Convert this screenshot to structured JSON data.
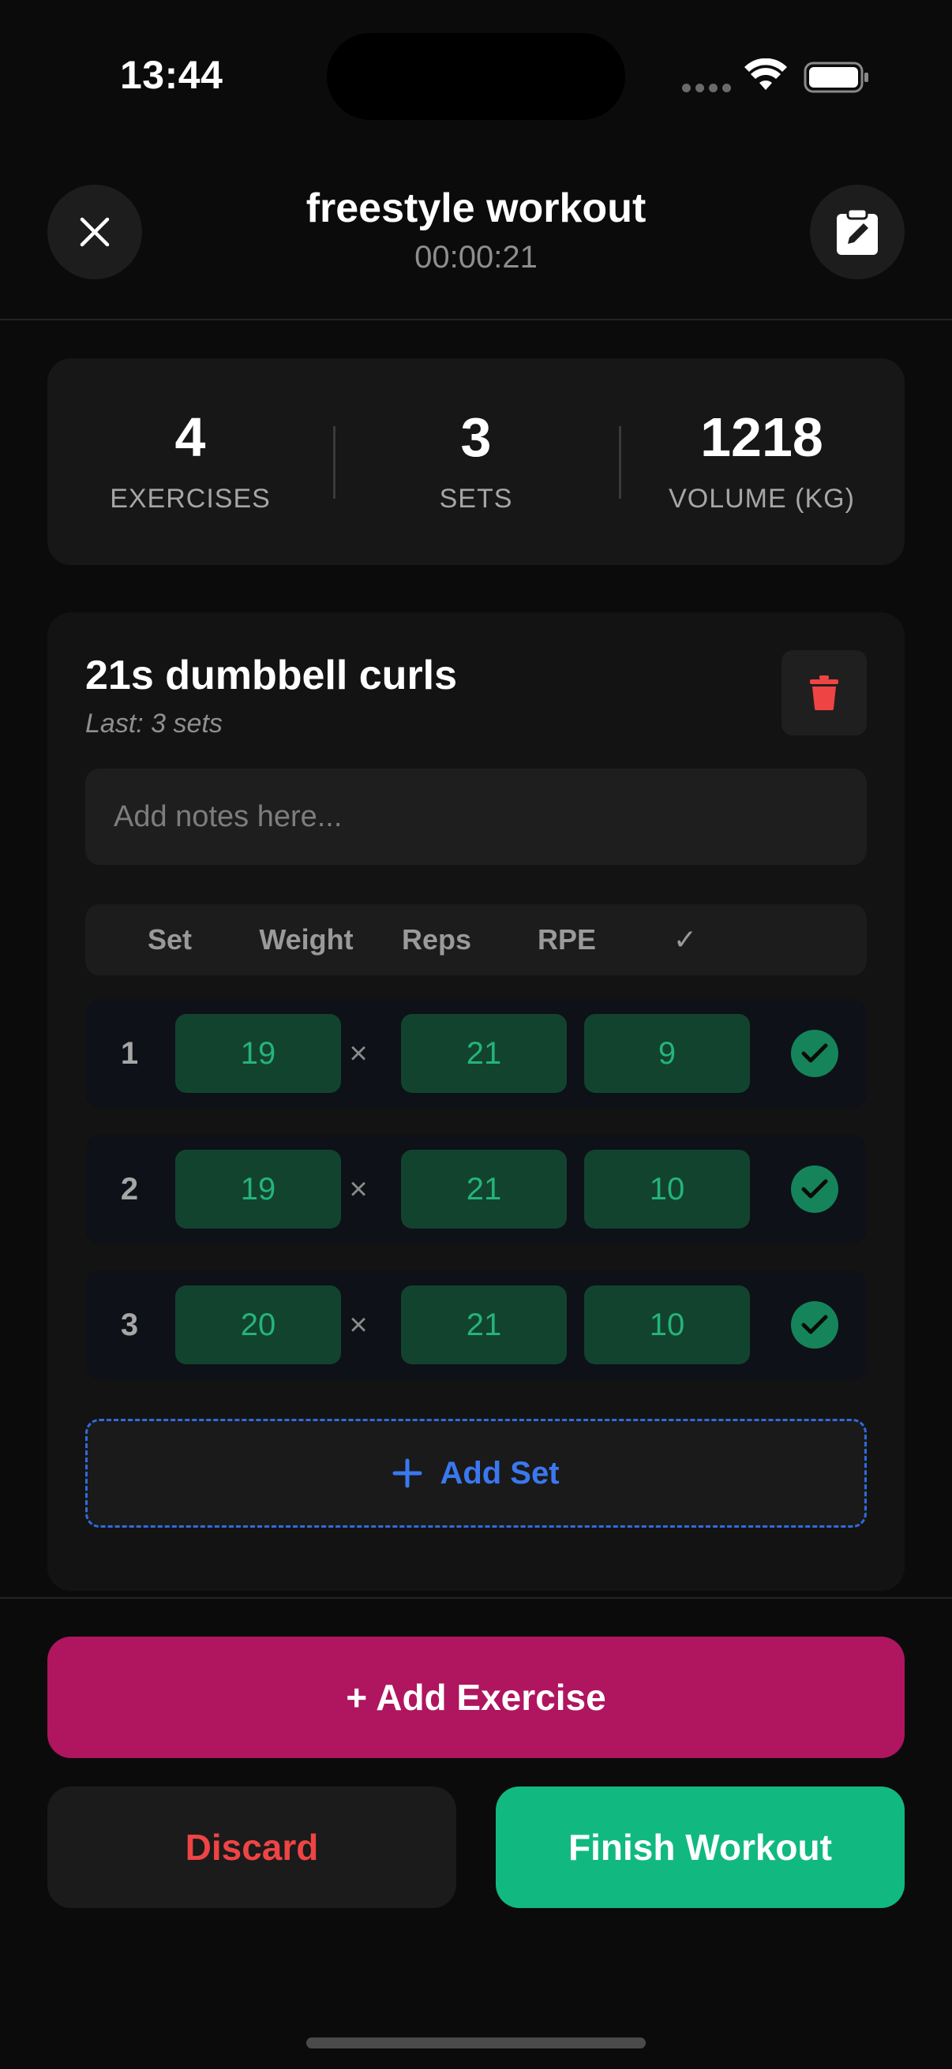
{
  "status_bar": {
    "time": "13:44"
  },
  "header": {
    "title": "freestyle workout",
    "timer": "00:00:21"
  },
  "stats": [
    {
      "value": "4",
      "label": "EXERCISES"
    },
    {
      "value": "3",
      "label": "SETS"
    },
    {
      "value": "1218",
      "label": "VOLUME (KG)"
    }
  ],
  "exercise": {
    "name": "21s dumbbell curls",
    "last": "Last: 3 sets",
    "notes_placeholder": "Add notes here...",
    "columns": {
      "set": "Set",
      "weight": "Weight",
      "reps": "Reps",
      "rpe": "RPE",
      "done": "✓"
    },
    "times_symbol": "×",
    "sets": [
      {
        "set": "1",
        "weight": "19",
        "reps": "21",
        "rpe": "9",
        "completed": true
      },
      {
        "set": "2",
        "weight": "19",
        "reps": "21",
        "rpe": "10",
        "completed": true
      },
      {
        "set": "3",
        "weight": "20",
        "reps": "21",
        "rpe": "10",
        "completed": true
      }
    ],
    "add_set_label": "Add Set"
  },
  "actions": {
    "add_exercise": "+ Add Exercise",
    "discard": "Discard",
    "finish": "Finish Workout"
  },
  "colors": {
    "accent_pink": "#b0155f",
    "accent_green": "#11b981",
    "danger_red": "#ef4444",
    "link_blue": "#3b78f0"
  },
  "icons": [
    "close-icon",
    "edit-clipboard-icon",
    "trash-icon",
    "check-circle-icon",
    "plus-icon",
    "wifi-icon",
    "battery-icon"
  ]
}
